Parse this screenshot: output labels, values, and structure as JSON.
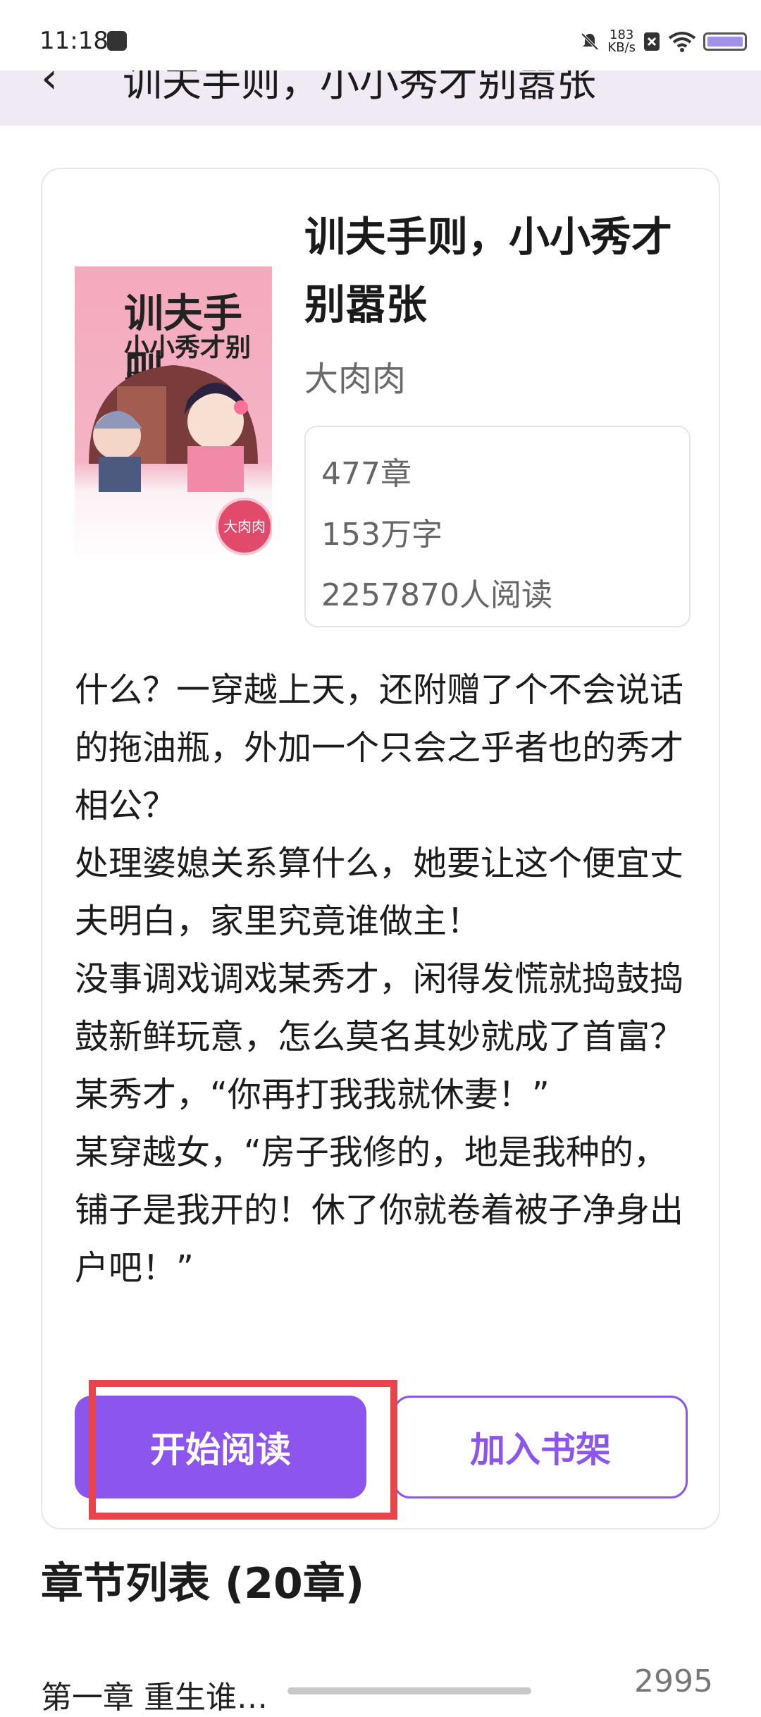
{
  "status_bar": {
    "time": "11:18",
    "net_speed_value": "183",
    "net_speed_unit": "KB/s"
  },
  "header": {
    "back_icon": "chevron-left-icon",
    "title": "训夫手则，小小秀才别嚣张"
  },
  "book": {
    "cover": {
      "title_line1": "训夫手则",
      "title_line2": "小小秀才别嚣张",
      "seal_text": "大肉肉"
    },
    "title": "训夫手则，小小秀才别嚣张",
    "author": "大肉肉",
    "stats": {
      "chapters": "477章",
      "words": "153万字",
      "readers": "2257870人阅读"
    },
    "description": [
      "什么？一穿越上天，还附赠了个不会说话的拖油瓶，外加一个只会之乎者也的秀才相公？",
      "处理婆媳关系算什么，她要让这个便宜丈夫明白，家里究竟谁做主！",
      "没事调戏调戏某秀才，闲得发慌就捣鼓捣鼓新鲜玩意，怎么莫名其妙就成了首富？",
      "某秀才，“你再打我我就休妻！”",
      "某穿越女，“房子我修的，地是我种的，铺子是我开的！休了你就卷着被子净身出户吧！”"
    ]
  },
  "actions": {
    "start_reading": "开始阅读",
    "add_to_shelf": "加入书架"
  },
  "chapters": {
    "heading": "章节列表 (20章)",
    "first_item_partial": "第一章 重生谁…",
    "first_item_words_partial": "2995"
  },
  "colors": {
    "accent": "#8b55ee",
    "highlight_box": "#e8454a",
    "header_bg": "#efeaf4"
  }
}
